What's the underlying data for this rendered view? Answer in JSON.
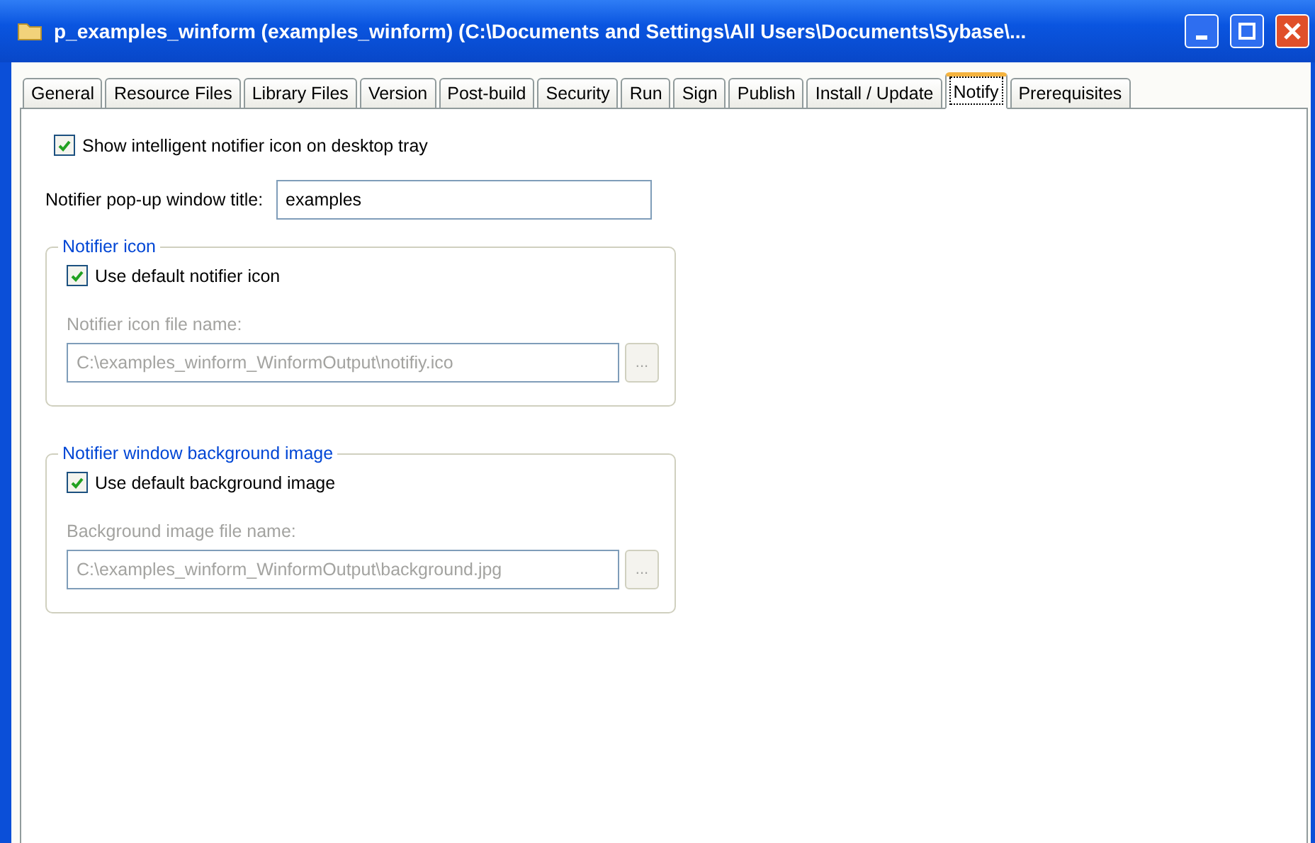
{
  "window": {
    "title": "p_examples_winform (examples_winform) (C:\\Documents and Settings\\All Users\\Documents\\Sybase\\..."
  },
  "tabs": [
    {
      "label": "General",
      "selected": false
    },
    {
      "label": "Resource Files",
      "selected": false
    },
    {
      "label": "Library Files",
      "selected": false
    },
    {
      "label": "Version",
      "selected": false
    },
    {
      "label": "Post-build",
      "selected": false
    },
    {
      "label": "Security",
      "selected": false
    },
    {
      "label": "Run",
      "selected": false
    },
    {
      "label": "Sign",
      "selected": false
    },
    {
      "label": "Publish",
      "selected": false
    },
    {
      "label": "Install / Update",
      "selected": false
    },
    {
      "label": "Notify",
      "selected": true
    },
    {
      "label": "Prerequisites",
      "selected": false
    }
  ],
  "show_notifier": {
    "label": "Show intelligent notifier icon on desktop tray",
    "checked": true
  },
  "title_field": {
    "label": "Notifier pop-up window title:",
    "value": "examples"
  },
  "groups": [
    {
      "title": "Notifier icon",
      "checkbox": {
        "label": "Use default notifier icon",
        "checked": true
      },
      "file_label": "Notifier icon file name:",
      "file_value": "C:\\examples_winform_WinformOutput\\notifiy.ico",
      "browse": "...",
      "disabled": true
    },
    {
      "title": "Notifier window background image",
      "checkbox": {
        "label": "Use default background image",
        "checked": true
      },
      "file_label": "Background image file name:",
      "file_value": "C:\\examples_winform_WinformOutput\\background.jpg",
      "browse": "...",
      "disabled": true
    }
  ]
}
